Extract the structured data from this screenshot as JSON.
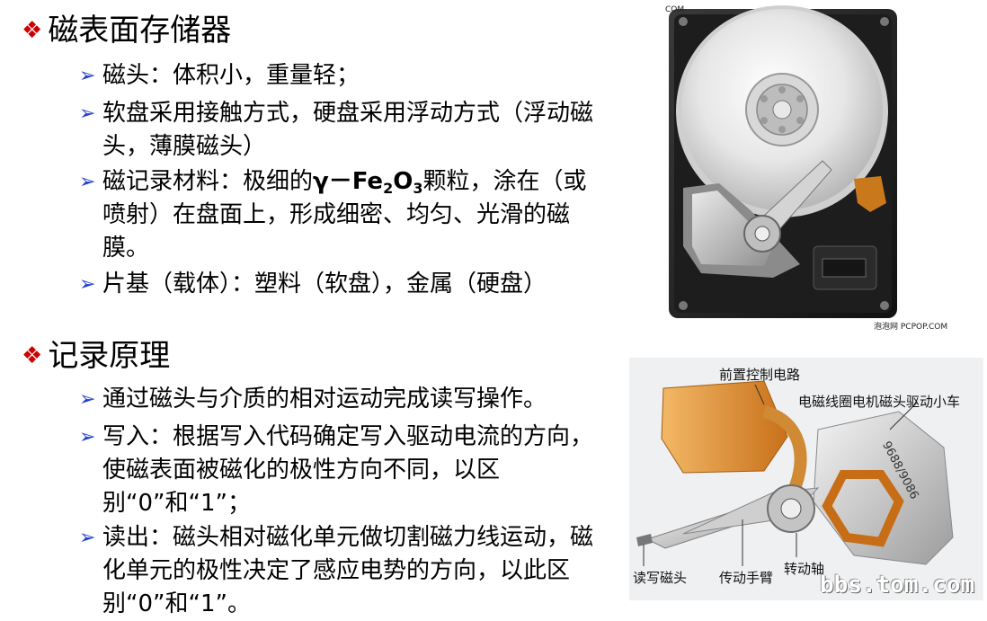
{
  "section1": {
    "bullet": "❖",
    "title": "磁表面存储器",
    "items": [
      "磁头：体积小，重量轻；",
      "软盘采用接触方式，硬盘采用浮动方式（浮动磁头，薄膜磁头）",
      {
        "before": "磁记录材料：极细的",
        "chem_a": "γ－Fe",
        "sub1": "2",
        "chem_b": "O",
        "sub2": "3",
        "after": "颗粒，涂在（或喷射）在盘面上，形成细密、均匀、光滑的磁膜。"
      },
      "片基（载体）：塑料（软盘），金属（硬盘）"
    ]
  },
  "section2": {
    "bullet": "❖",
    "title": "记录原理",
    "items": [
      "通过磁头与介质的相对运动完成读写操作。",
      "写入：根据写入代码确定写入驱动电流的方向，使磁表面被磁化的极性方向不同，以区别“0”和“1”；",
      "读出：磁头相对磁化单元做切割磁力线运动，磁化单元的极性决定了感应电势的方向，以此区别“0”和“1”。"
    ]
  },
  "item_arrow": "➢",
  "photo1": {
    "credit_top": "COM",
    "credit_bottom": "泡泡网 PCPOP.COM"
  },
  "photo2": {
    "labels": {
      "preamp": "前置控制电路",
      "vcm": "电磁线圈电机磁头驱动小车",
      "head": "读写磁头",
      "arm": "传动手臂",
      "pivot": "转动轴"
    },
    "stamp": "9688/9086",
    "watermark": "bbs.tom.com"
  },
  "colors": {
    "bullet": "#cc0000",
    "arrow": "#1f3ccc",
    "text": "#000000"
  }
}
